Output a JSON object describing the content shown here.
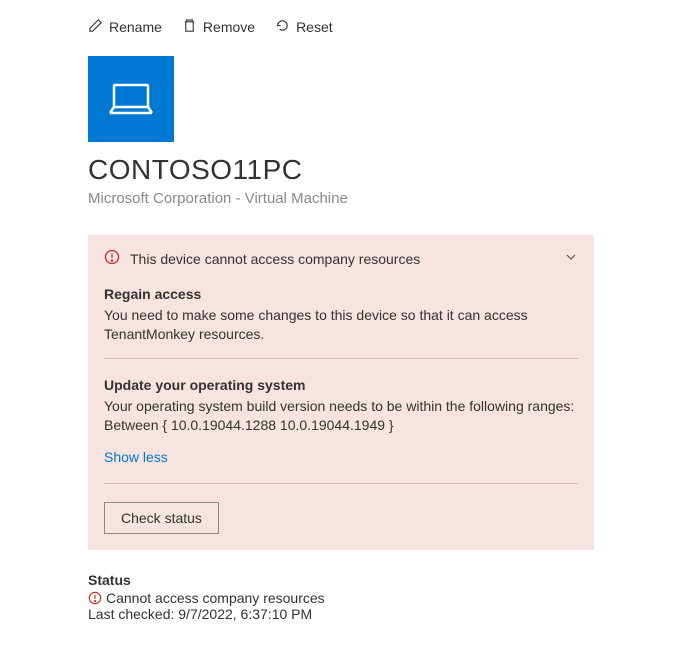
{
  "toolbar": {
    "rename": "Rename",
    "remove": "Remove",
    "reset": "Reset"
  },
  "device": {
    "name": "CONTOSO11PC",
    "subtitle": "Microsoft Corporation - Virtual Machine"
  },
  "alert": {
    "title": "This device cannot access company resources",
    "regain_heading": "Regain access",
    "regain_text": "You need to make some changes to this device so that it can access TenantMonkey resources.",
    "update_heading": "Update your operating system",
    "update_text": "Your operating system build version needs to be within the following ranges: Between { 10.0.19044.1288 10.0.19044.1949 }",
    "show_less": "Show less",
    "check_status": "Check status"
  },
  "status": {
    "heading": "Status",
    "message": "Cannot access company resources",
    "last_checked": "Last checked: 9/7/2022, 6:37:10 PM"
  }
}
